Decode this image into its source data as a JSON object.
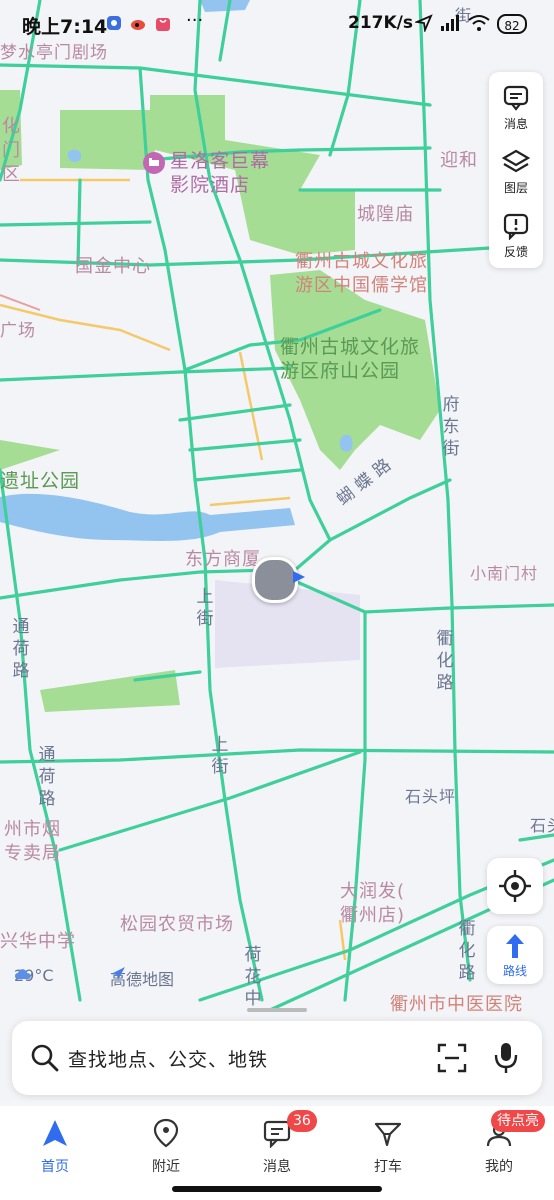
{
  "status_bar": {
    "time": "晚上7:14",
    "more": "···",
    "net_speed": "217K/s",
    "battery": "82"
  },
  "map_labels": {
    "poi_top_left": "梦水亭门剧场",
    "poi_hotel": "星洛客巨幕影院酒店",
    "poi_hotel_line1": "星洛客巨幕",
    "poi_hotel_line2": "影院酒店",
    "poi_cheng_huang": "城隍庙",
    "poi_guojin": "国金中心",
    "poi_rujia_1": "衢州古城文化旅",
    "poi_rujia_2": "游区中国儒学馆",
    "poi_fushan_1": "衢州古城文化旅",
    "poi_fushan_2": "游区府山公园",
    "poi_guangchang": "广场",
    "poi_yizhi": "遗址公园",
    "poi_dongfang": "东方商厦",
    "poi_xiaonanmen": "小南门村",
    "poi_shitouping": "石头坪",
    "poi_yanchao_1": "州市烟",
    "poi_yanchao_2": "专卖局",
    "poi_dirunfa_1": "大润发(",
    "poi_dirunfa_2": "衢州店)",
    "poi_songyuan": "松园农贸市场",
    "poi_huazhong": "兴华中学",
    "poi_hospital": "衢州市中医医院",
    "poi_left_partial_1": "化",
    "poi_left_partial_2": "门",
    "poi_left_partial_3": "区",
    "poi_right_partial": "迎和",
    "poi_right_partial_2": "石头",
    "road_fudong": "府东街",
    "road_hudie": "蝴蝶路",
    "road_shang_1": "上街",
    "road_shang_2": "上街",
    "road_tonghe_1": "通荷路",
    "road_tonghe_2": "通荷路",
    "road_quhua_1": "衢化路",
    "road_quhua_2": "衢化路",
    "road_hehua": "荷花中",
    "road_top_right": "街"
  },
  "side_panel": {
    "messages": "消息",
    "layers": "图层",
    "feedback": "反馈"
  },
  "route_button": "路线",
  "weather": "29°C",
  "brand": "高德地图",
  "search": {
    "placeholder": "查找地点、公交、地铁"
  },
  "tabs": [
    {
      "label": "首页"
    },
    {
      "label": "附近"
    },
    {
      "label": "消息",
      "badge": "36"
    },
    {
      "label": "打车"
    },
    {
      "label": "我的",
      "badge": "待点亮"
    }
  ],
  "colors": {
    "road": "#3ecf9a",
    "park": "#a6dd95",
    "water": "#93c4f0",
    "accent": "#2f6cf0",
    "badge": "#f04848"
  }
}
